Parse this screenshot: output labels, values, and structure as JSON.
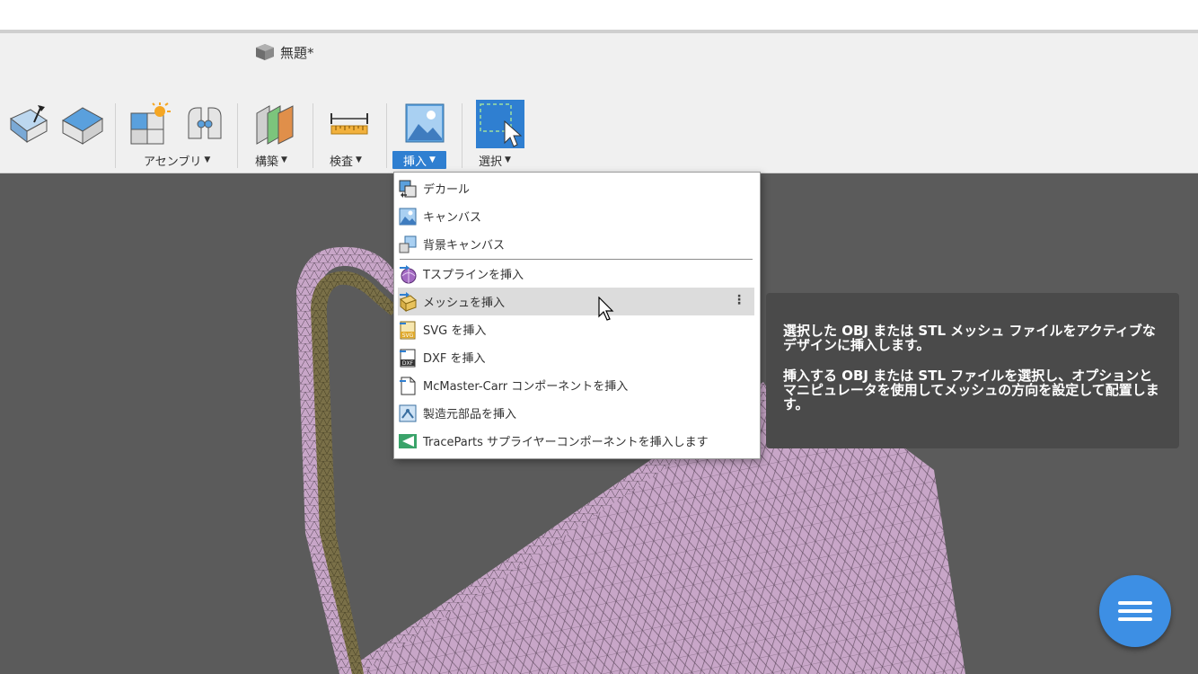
{
  "document": {
    "title": "無題*",
    "icon": "document-box-icon"
  },
  "toolbar": {
    "groups": {
      "assembly": {
        "label": "アセンブリ"
      },
      "construct": {
        "label": "構築"
      },
      "inspect": {
        "label": "検査"
      },
      "insert": {
        "label": "挿入"
      },
      "select": {
        "label": "選択"
      }
    },
    "icons": [
      "push-pull-icon",
      "shell-icon",
      "new-component-icon",
      "joint-icon",
      "offset-plane-icon",
      "measure-icon",
      "insert-canvas-icon",
      "select-icon"
    ]
  },
  "insert_menu": {
    "items": [
      {
        "label": "デカール",
        "icon": "decal-icon"
      },
      {
        "label": "キャンバス",
        "icon": "canvas-icon"
      },
      {
        "label": "背景キャンバス",
        "icon": "background-canvas-icon"
      },
      {
        "label": "Tスプラインを挿入",
        "icon": "tspline-icon"
      },
      {
        "label": "メッシュを挿入",
        "icon": "mesh-icon",
        "highlighted": true
      },
      {
        "label": "SVG を挿入",
        "icon": "svg-icon"
      },
      {
        "label": "DXF を挿入",
        "icon": "dxf-icon"
      },
      {
        "label": "McMaster-Carr コンポーネントを挿入",
        "icon": "mcmaster-icon"
      },
      {
        "label": "製造元部品を挿入",
        "icon": "manufacturer-part-icon"
      },
      {
        "label": "TraceParts サプライヤーコンポーネントを挿入します",
        "icon": "traceparts-icon"
      }
    ],
    "more_glyph": "⋮"
  },
  "tooltip": {
    "paragraph1": "選択した OBJ または STL メッシュ ファイルをアクティブなデザインに挿入します。",
    "paragraph2": "挿入する OBJ または STL ファイルを選択し、オプションとマニピュレータを使用してメッシュの方向を設定して配置します。"
  },
  "colors": {
    "accent": "#2f7fd1",
    "fab": "#3d8fe4",
    "mesh": "#c8a6c8",
    "viewport": "#5b5b5b"
  }
}
